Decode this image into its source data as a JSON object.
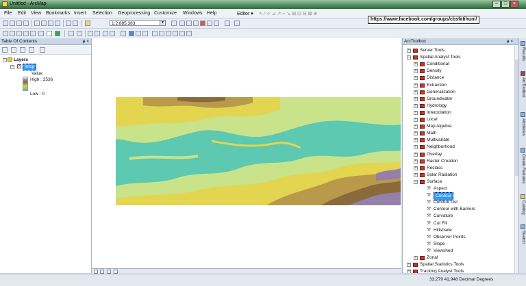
{
  "window": {
    "title": "Untitled - ArcMap"
  },
  "menu": [
    "File",
    "Edit",
    "View",
    "Bookmarks",
    "Insert",
    "Selection",
    "Geoprocessing",
    "Customize",
    "Windows",
    "Help"
  ],
  "editor_label": "Editor ▾",
  "toolbar": {
    "scale": "1:2.885.383"
  },
  "overlay_url": "https://www.facebook.com/groups/cbsfatihuni/",
  "toc": {
    "title": "Table Of Contents",
    "pin": "ᵽ ×",
    "layers_label": "Layers",
    "layer_name": "Intop",
    "value_label": "Value",
    "high_label": "High : 2536",
    "low_label": "Low : 0"
  },
  "arctoolbox": {
    "title": "ArcToolbox",
    "pin": "ᵽ ×",
    "items": [
      {
        "label": "Server Tools",
        "level": 0,
        "kind": "box",
        "exp": "+"
      },
      {
        "label": "Spatial Analyst Tools",
        "level": 0,
        "kind": "box",
        "exp": "−"
      },
      {
        "label": "Conditional",
        "level": 1,
        "kind": "box",
        "exp": "+"
      },
      {
        "label": "Density",
        "level": 1,
        "kind": "box",
        "exp": "+"
      },
      {
        "label": "Distance",
        "level": 1,
        "kind": "box",
        "exp": "+"
      },
      {
        "label": "Extraction",
        "level": 1,
        "kind": "box",
        "exp": "+"
      },
      {
        "label": "Generalization",
        "level": 1,
        "kind": "box",
        "exp": "+"
      },
      {
        "label": "Groundwater",
        "level": 1,
        "kind": "box",
        "exp": "+"
      },
      {
        "label": "Hydrology",
        "level": 1,
        "kind": "box",
        "exp": "+"
      },
      {
        "label": "Interpolation",
        "level": 1,
        "kind": "box",
        "exp": "+"
      },
      {
        "label": "Local",
        "level": 1,
        "kind": "box",
        "exp": "+"
      },
      {
        "label": "Map Algebra",
        "level": 1,
        "kind": "box",
        "exp": "+"
      },
      {
        "label": "Math",
        "level": 1,
        "kind": "box",
        "exp": "+"
      },
      {
        "label": "Multivariate",
        "level": 1,
        "kind": "box",
        "exp": "+"
      },
      {
        "label": "Neighborhood",
        "level": 1,
        "kind": "box",
        "exp": "+"
      },
      {
        "label": "Overlay",
        "level": 1,
        "kind": "box",
        "exp": "+"
      },
      {
        "label": "Raster Creation",
        "level": 1,
        "kind": "box",
        "exp": "+"
      },
      {
        "label": "Reclass",
        "level": 1,
        "kind": "box",
        "exp": "+"
      },
      {
        "label": "Solar Radiation",
        "level": 1,
        "kind": "box",
        "exp": "+"
      },
      {
        "label": "Surface",
        "level": 1,
        "kind": "box",
        "exp": "−"
      },
      {
        "label": "Aspect",
        "level": 2,
        "kind": "tool",
        "exp": ""
      },
      {
        "label": "Contour",
        "level": 2,
        "kind": "tool",
        "exp": "",
        "selected": true
      },
      {
        "label": "Contour List",
        "level": 2,
        "kind": "tool",
        "exp": ""
      },
      {
        "label": "Contour with Barriers",
        "level": 2,
        "kind": "tool",
        "exp": ""
      },
      {
        "label": "Curvature",
        "level": 2,
        "kind": "tool",
        "exp": ""
      },
      {
        "label": "Cut Fill",
        "level": 2,
        "kind": "tool",
        "exp": ""
      },
      {
        "label": "Hillshade",
        "level": 2,
        "kind": "tool",
        "exp": ""
      },
      {
        "label": "Observer Points",
        "level": 2,
        "kind": "tool",
        "exp": ""
      },
      {
        "label": "Slope",
        "level": 2,
        "kind": "tool",
        "exp": ""
      },
      {
        "label": "Viewshed",
        "level": 2,
        "kind": "tool",
        "exp": ""
      },
      {
        "label": "Zonal",
        "level": 1,
        "kind": "box",
        "exp": "+"
      },
      {
        "label": "Spatial Statistics Tools",
        "level": 0,
        "kind": "box",
        "exp": "+"
      },
      {
        "label": "Tracking Analyst Tools",
        "level": 0,
        "kind": "box",
        "exp": "+"
      }
    ]
  },
  "dock_tabs": [
    "Results",
    "ArcToolbox",
    "Attributes",
    "Create Features",
    "Catalog",
    "Search"
  ],
  "status": {
    "coords": "33,279  41,948 Decimal Degrees"
  },
  "colors": {
    "water": "#5cc9b0",
    "low_land": "#c8e38a",
    "mid": "#e4d550",
    "high": "#8a6a3a",
    "peak": "#9480a8"
  }
}
